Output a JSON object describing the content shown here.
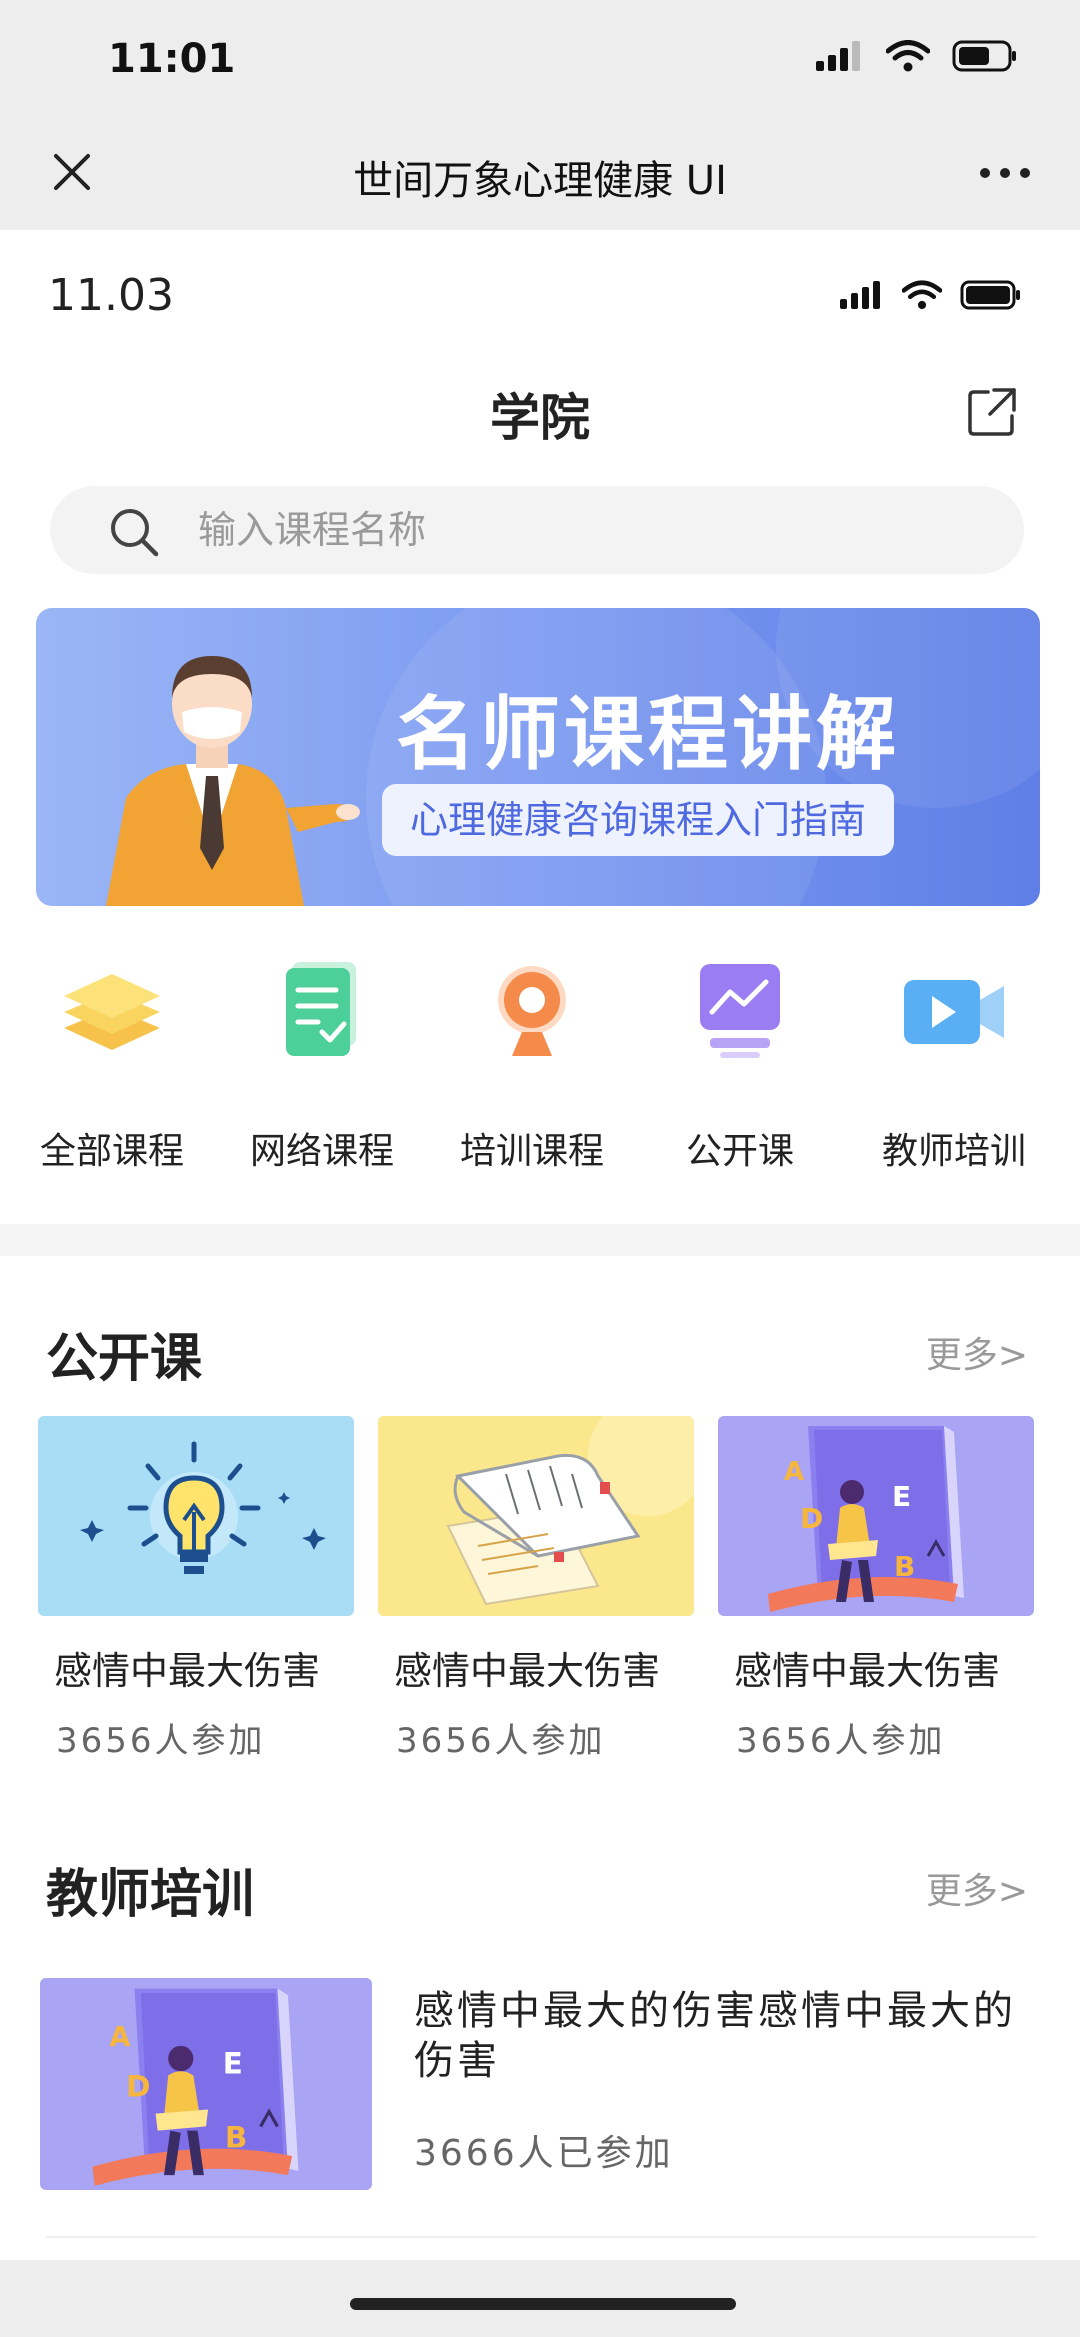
{
  "outer_status": {
    "time": "11:01"
  },
  "wechat_bar": {
    "title": "世间万象心理健康 UI"
  },
  "inner_status": {
    "time": "11.03"
  },
  "nav": {
    "title": "学院"
  },
  "search": {
    "placeholder": "输入课程名称"
  },
  "banner": {
    "title": "名师课程讲解",
    "subtitle": "心理健康咨询课程入门指南"
  },
  "categories": [
    {
      "label": "全部课程",
      "icon": "layers-icon"
    },
    {
      "label": "网络课程",
      "icon": "checklist-icon"
    },
    {
      "label": "培训课程",
      "icon": "webcam-icon"
    },
    {
      "label": "公开课",
      "icon": "chart-monitor-icon"
    },
    {
      "label": "教师培训",
      "icon": "video-camera-icon"
    }
  ],
  "open_courses": {
    "title": "公开课",
    "more": "更多>",
    "items": [
      {
        "title": "感情中最大伤害",
        "count": "3656人参加",
        "image": "lightbulb-illustration"
      },
      {
        "title": "感情中最大伤害",
        "count": "3656人参加",
        "image": "book-illustration"
      },
      {
        "title": "感情中最大伤害",
        "count": "3656人参加",
        "image": "reading-girl-illustration"
      }
    ]
  },
  "teacher_training": {
    "title": "教师培训",
    "more": "更多>",
    "items": [
      {
        "title": "感情中最大的伤害感情中最大的伤害",
        "count": "3666人已参加",
        "image": "reading-girl-illustration"
      }
    ]
  },
  "colors": {
    "banner_start": "#9bb6f6",
    "banner_end": "#5f7fe7",
    "accent_blue": "#4f6ae0",
    "muted_text": "#999999"
  }
}
